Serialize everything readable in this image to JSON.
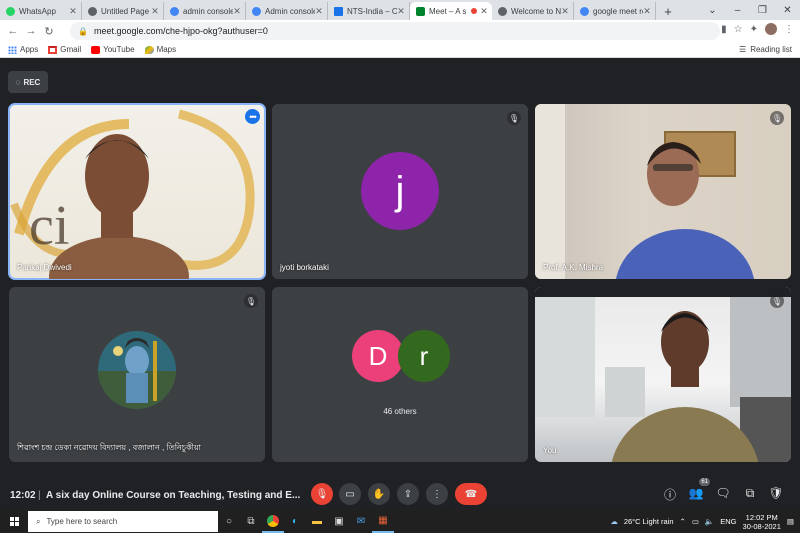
{
  "browser": {
    "tabs": [
      {
        "title": "WhatsApp",
        "color": "#25d366"
      },
      {
        "title": "Untitled Page",
        "color": "#5f6368"
      },
      {
        "title": "admin console",
        "color": "#4285f4"
      },
      {
        "title": "Admin console",
        "color": "#4285f4"
      },
      {
        "title": "NTS-India – Ca",
        "color": "#1a73e8"
      },
      {
        "title": "Meet – A s",
        "color": "#00832d"
      },
      {
        "title": "Welcome to NT",
        "color": "#5f6368"
      },
      {
        "title": "google meet re",
        "color": "#4285f4"
      }
    ],
    "url": "meet.google.com/che-hjpo-okg?authuser=0",
    "bookmarks": [
      {
        "label": "Apps"
      },
      {
        "label": "Gmail"
      },
      {
        "label": "YouTube"
      },
      {
        "label": "Maps"
      }
    ],
    "reading_list": "Reading list"
  },
  "meet": {
    "rec_label": "REC",
    "tiles": [
      {
        "name": "Pankaj Dwivedi"
      },
      {
        "name": "jyoti borkataki",
        "initial": "j",
        "avatar_color": "#8e24aa"
      },
      {
        "name": "Prof. A.K. Mishra"
      },
      {
        "name": "শিৱাংশ চন্দ্ৰ ডেকা নৱোদয় বিদ্যালয় , বজালান , তিনিচুকীয়া"
      },
      {
        "others_label": "46 others",
        "initials": [
          "D",
          "r"
        ],
        "colors": [
          "#ec407a",
          "#33691e"
        ]
      },
      {
        "name": "You"
      }
    ],
    "bottom": {
      "time": "12:02",
      "separator": "|",
      "title": "A six day Online Course on Teaching, Testing and E...",
      "participant_count": "61"
    }
  },
  "taskbar": {
    "search_placeholder": "Type here to search",
    "weather": "26°C  Light rain",
    "lang": "ENG",
    "time": "12:02 PM",
    "date": "30-08-2021"
  }
}
